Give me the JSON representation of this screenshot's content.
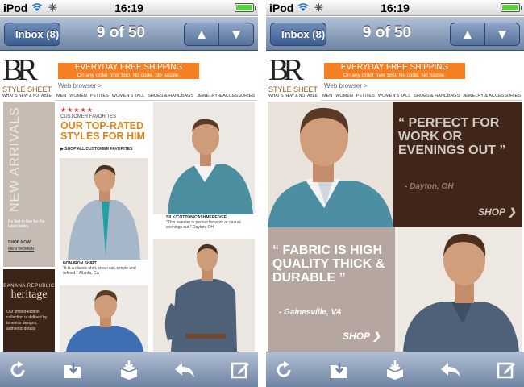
{
  "status": {
    "carrier": "iPod",
    "time": "16:19"
  },
  "nav": {
    "back_label": "Inbox (8)",
    "message_counter": "9 of 50"
  },
  "email": {
    "brand_initials": "BR",
    "brand_name": "STYLE SHEET",
    "brand_tagline": "WHAT'S NEW & NOTABLE",
    "shipping_line1": "EVERYDAY FREE SHIPPING",
    "shipping_line2": "On any order over $50. No code. No hassle.",
    "web_browser": "Web browser >",
    "categories": [
      "MEN",
      "WOMEN",
      "PETITES",
      "WOMEN'S TALL",
      "SHOES & HANDBAGS",
      "JEWELRY & ACCESSORIES"
    ]
  },
  "page1": {
    "new_arrivals": "NEW ARRIVALS",
    "be_first": "Be first in line for the latest looks.",
    "shop_now": "SHOP NOW:",
    "shop_links": "MEN  WOMEN",
    "stars": "★★★★★",
    "customer_favorites": "CUSTOMER FAVORITES",
    "headline": "OUR TOP-RATED STYLES FOR HIM",
    "shop_all": "▶ SHOP ALL CUSTOMER FAVORITES",
    "caption1_title": "SILK/COTTON/CASHMERE VEE",
    "caption1_text": "\"This sweater is perfect for work or casual evenings out.\" Dayton, OH",
    "caption2_title": "NON-IRON SHIRT",
    "caption2_text": "\"It is a classic shirt, clean cut, simple and refined.\" Atlanta, GA",
    "heritage_brand": "BANANA REPUBLIC",
    "heritage_title": "heritage",
    "heritage_text": "Our limited-edition collection is defined by timeless designs, authentic details"
  },
  "page2": {
    "quote1": "“ PERFECT FOR WORK OR EVENINGS OUT ”",
    "quote1_attr": "- Dayton, OH",
    "quote2": "“ FABRIC IS HIGH QUALITY THICK & DURABLE ”",
    "quote2_attr": "- Gainesville, VA",
    "shop_label": "SHOP ❯"
  },
  "colors": {
    "nav_blue": "#6d84a4",
    "shipping_orange": "#f58024",
    "headline_orange": "#d9861e",
    "quote_brown": "#402618",
    "quote_taupe": "#b5a7a0"
  }
}
